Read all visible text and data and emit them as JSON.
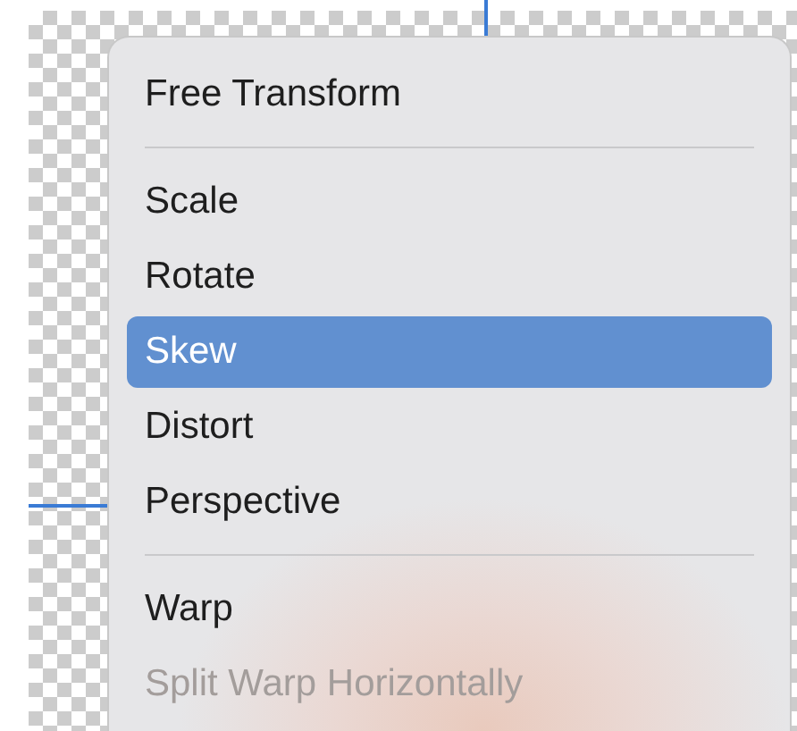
{
  "menu": {
    "sections": [
      {
        "items": [
          {
            "label": "Free Transform",
            "selected": false,
            "disabled": false
          }
        ]
      },
      {
        "items": [
          {
            "label": "Scale",
            "selected": false,
            "disabled": false
          },
          {
            "label": "Rotate",
            "selected": false,
            "disabled": false
          },
          {
            "label": "Skew",
            "selected": true,
            "disabled": false
          },
          {
            "label": "Distort",
            "selected": false,
            "disabled": false
          },
          {
            "label": "Perspective",
            "selected": false,
            "disabled": false
          }
        ]
      },
      {
        "items": [
          {
            "label": "Warp",
            "selected": false,
            "disabled": false
          },
          {
            "label": "Split Warp Horizontally",
            "selected": false,
            "disabled": true
          }
        ]
      }
    ]
  }
}
